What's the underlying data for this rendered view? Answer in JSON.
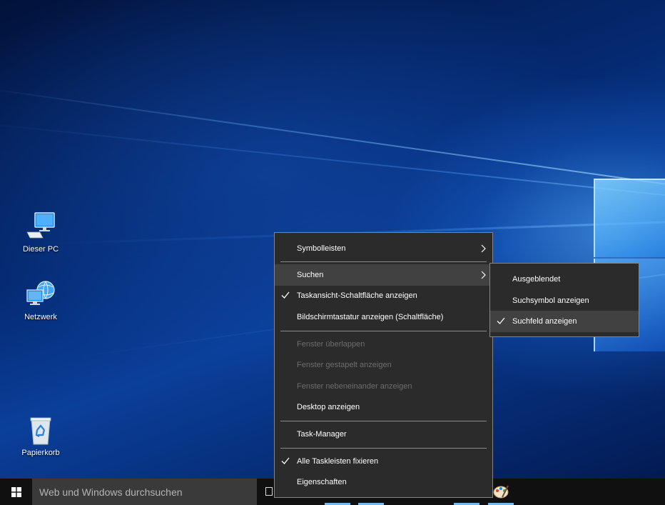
{
  "desktop": {
    "icons": [
      {
        "label": "Dieser PC",
        "icon": "computer-icon"
      },
      {
        "label": "Netzwerk",
        "icon": "network-icon"
      },
      {
        "label": "Papierkorb",
        "icon": "recycle-bin-icon"
      }
    ]
  },
  "taskbar": {
    "search_placeholder": "Web und Windows durchsuchen",
    "start_icon": "windows-logo-icon",
    "task_view_icon": "task-view-icon",
    "tray_icon": "paint-icon"
  },
  "context_menu": {
    "items": [
      {
        "label": "Symbolleisten",
        "checked": false,
        "enabled": true,
        "submenu": true
      },
      {
        "label": "Suchen",
        "checked": false,
        "enabled": true,
        "submenu": true,
        "highlighted": true
      },
      {
        "label": "Taskansicht-Schaltfläche anzeigen",
        "checked": true,
        "enabled": true
      },
      {
        "label": "Bildschirmtastatur anzeigen (Schaltfläche)",
        "checked": false,
        "enabled": true
      },
      {
        "label": "Fenster überlappen",
        "checked": false,
        "enabled": false
      },
      {
        "label": "Fenster gestapelt anzeigen",
        "checked": false,
        "enabled": false
      },
      {
        "label": "Fenster nebeneinander anzeigen",
        "checked": false,
        "enabled": false
      },
      {
        "label": "Desktop anzeigen",
        "checked": false,
        "enabled": true
      },
      {
        "label": "Task-Manager",
        "checked": false,
        "enabled": true
      },
      {
        "label": "Alle Taskleisten fixieren",
        "checked": true,
        "enabled": true
      },
      {
        "label": "Eigenschaften",
        "checked": false,
        "enabled": true
      }
    ]
  },
  "search_submenu": {
    "items": [
      {
        "label": "Ausgeblendet",
        "checked": false
      },
      {
        "label": "Suchsymbol anzeigen",
        "checked": false
      },
      {
        "label": "Suchfeld anzeigen",
        "checked": true,
        "highlighted": true
      }
    ]
  },
  "colors": {
    "menu_bg": "#2b2b2b",
    "menu_highlight": "#414141",
    "disabled_text": "#6d6d6d",
    "taskbar_bg": "#101010",
    "accent": "#76b9ed"
  }
}
